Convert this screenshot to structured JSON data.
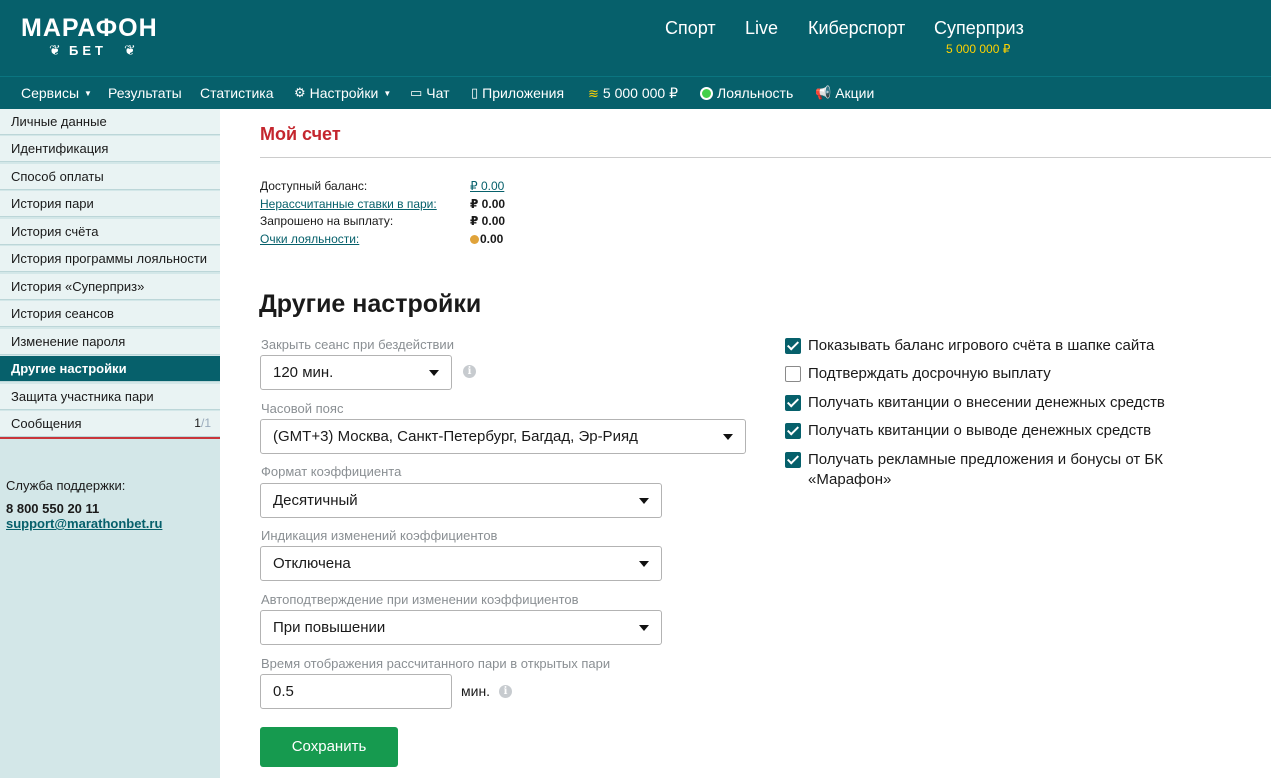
{
  "brand": {
    "name": "МАРАФОН",
    "sub": "БЕТ"
  },
  "topnav": {
    "items": [
      "Спорт",
      "Live",
      "Киберспорт",
      "Суперприз"
    ],
    "superprize_amount": "5 000 000 ₽"
  },
  "subnav": {
    "items": [
      "Сервисы",
      "Результаты",
      "Статистика",
      "Настройки",
      "Чат",
      "Приложения",
      "5 000 000 ₽",
      "Лояльность",
      "Акции"
    ]
  },
  "sidebar": {
    "items": [
      "Личные данные",
      "Идентификация",
      "Способ оплаты",
      "История пари",
      "История счёта",
      "История программы лояльности",
      "История «Суперприз»",
      "История сеансов",
      "Изменение пароля",
      "Другие настройки",
      "Защита участника пари",
      "Сообщения"
    ],
    "active_index": 9,
    "messages_count": "1",
    "messages_total": "/1",
    "support": {
      "title": "Служба поддержки:",
      "phone": "8 800 550 20 11",
      "email": "support@marathonbet.ru"
    }
  },
  "account": {
    "title": "Мой счет",
    "rows": [
      {
        "label": "Доступный баланс:",
        "value": "₽ 0.00"
      },
      {
        "label": "Нерассчитанные ставки в пари:",
        "value": "₽ 0.00"
      },
      {
        "label": "Запрошено на выплату:",
        "value": "₽ 0.00"
      },
      {
        "label": "Очки лояльности:",
        "value": "0.00"
      }
    ]
  },
  "settings": {
    "title": "Другие настройки",
    "session_label": "Закрыть сеанс при бездействии",
    "session_value": "120 мин.",
    "timezone_label": "Часовой пояс",
    "timezone_value": "(GMT+3) Москва, Санкт-Петербург, Багдад, Эр-Рияд",
    "odds_format_label": "Формат коэффициента",
    "odds_format_value": "Десятичный",
    "odds_change_label": "Индикация изменений коэффициентов",
    "odds_change_value": "Отключена",
    "autoconfirm_label": "Автоподтверждение при изменении коэффициентов",
    "autoconfirm_value": "При повышении",
    "display_time_label": "Время отображения рассчитанного пари в открытых пари",
    "display_time_value": "0.5",
    "display_time_unit": "мин.",
    "save_label": "Сохранить",
    "checkboxes": [
      {
        "label": "Показывать баланс игрового счёта в шапке сайта",
        "checked": true
      },
      {
        "label": "Подтверждать досрочную выплату",
        "checked": false
      },
      {
        "label": "Получать квитанции о внесении денежных средств",
        "checked": true
      },
      {
        "label": "Получать квитанции о выводе денежных средств",
        "checked": true
      },
      {
        "label": "Получать рекламные предложения и бонусы от БК «Марафон»",
        "checked": true
      }
    ]
  }
}
